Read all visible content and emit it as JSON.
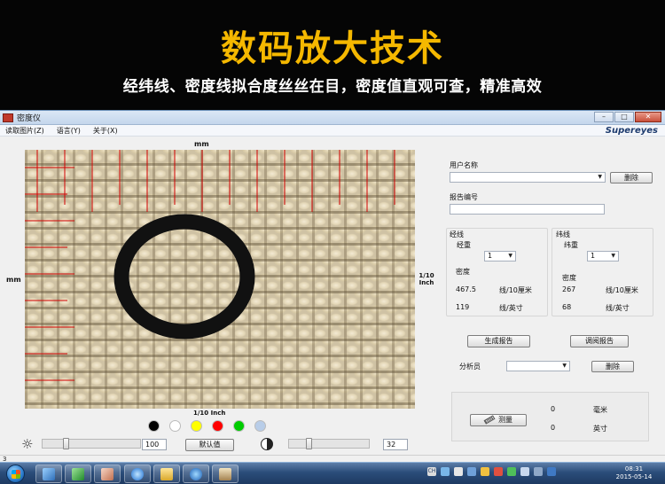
{
  "banner": {
    "headline": "数码放大技术",
    "subline": "经纬线、密度线拟合度丝丝在目，密度值直观可查，精准高效"
  },
  "window": {
    "title": "密度仪",
    "controls": {
      "minimize": "–",
      "maximize": "□",
      "close": "✕"
    },
    "menu": [
      "读取图片(Z)",
      "语言(Y)",
      "关于(X)"
    ],
    "brand": "Supereyes"
  },
  "image_area": {
    "top_unit": "mm",
    "left_unit": "mm",
    "right_unit_line1": "1/10",
    "right_unit_line2": "Inch",
    "bottom_unit": "1/10 Inch"
  },
  "swatches": [
    "#000000",
    "#ffffff",
    "#ffff00",
    "#ff0000",
    "#00cc00",
    "#b8cde8"
  ],
  "bottom_controls": {
    "brightness_value": "100",
    "default_button": "默认值",
    "contrast_value": "32",
    "brightness_level": 0.22,
    "contrast_level": 0.23
  },
  "panel": {
    "user_name_label": "用户名称",
    "delete_button": "删除",
    "report_no_label": "报告编号",
    "warp": {
      "group_title": "经线",
      "weight_label": "经重",
      "weight_value": "1",
      "density_label": "密度",
      "density_cm_value": "467.5",
      "density_cm_unit": "线/10厘米",
      "density_inch_value": "119",
      "density_inch_unit": "线/英寸"
    },
    "weft": {
      "group_title": "纬线",
      "weight_label": "纬重",
      "weight_value": "1",
      "density_label": "密度",
      "density_cm_value": "267",
      "density_cm_unit": "线/10厘米",
      "density_inch_value": "68",
      "density_inch_unit": "线/英寸"
    },
    "generate_report": "生成报告",
    "view_report": "调阅报告",
    "analyst_label": "分析员",
    "analyst_delete": "删除",
    "measure_button": "测量",
    "measure_mm_value": "0",
    "measure_mm_unit": "毫米",
    "measure_inch_value": "0",
    "measure_inch_unit": "英寸"
  },
  "statusbar": {
    "text": "3"
  },
  "taskbar": {
    "time": "08:31",
    "date": "2015-05-14",
    "tray_lang": "CH"
  }
}
